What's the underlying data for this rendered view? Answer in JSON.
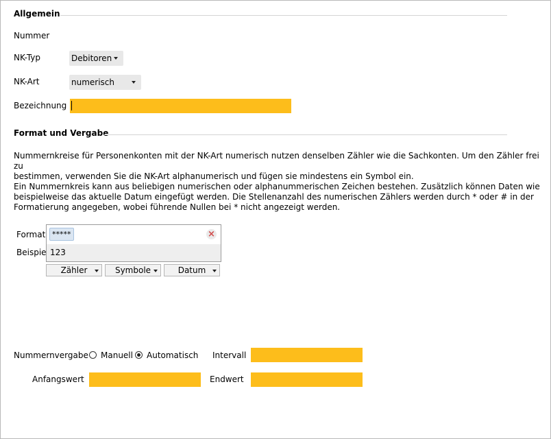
{
  "allgemein": {
    "title": "Allgemein",
    "nummer_label": "Nummer",
    "nktyp_label": "NK-Typ",
    "nktyp_value": "Debitoren",
    "nkart_label": "NK-Art",
    "nkart_value": "numerisch",
    "bezeichnung_label": "Bezeichnung",
    "bezeichnung_value": ""
  },
  "format_section": {
    "title": "Format und Vergabe",
    "paragraph1_line1": "Nummernkreise für Personenkonten mit der NK-Art numerisch nutzen denselben Zähler wie die Sachkonten. Um den Zähler frei zu",
    "paragraph1_line2": "bestimmen, verwenden Sie die NK-Art alphanumerisch und fügen sie mindestens ein Symbol ein.",
    "paragraph2_line1": "Ein Nummernkreis kann aus beliebigen numerischen oder alphanummerischen Zeichen bestehen. Zusätzlich können Daten wie",
    "paragraph2_line2": "beispielweise das aktuelle Datum eingefügt werden. Die Stellenanzahl des numerischen Zählers werden durch * oder # in der",
    "paragraph2_line3": "Formatierung angegeben, wobei führende Nullen bei * nicht angezeigt werden.",
    "format_label": "Format",
    "format_token": "*****",
    "beispiel_label": "Beispiel",
    "beispiel_value": "123",
    "buttons": {
      "zaehler": "Zähler",
      "symbole": "Symbole",
      "datum": "Datum"
    }
  },
  "vergabe": {
    "nummernvergabe_label": "Nummernvergabe",
    "option_manuell": "Manuell",
    "option_automatisch": "Automatisch",
    "selected": "Automatisch",
    "intervall_label": "Intervall",
    "intervall_value": "",
    "anfangswert_label": "Anfangswert",
    "anfangswert_value": "",
    "endwert_label": "Endwert",
    "endwert_value": ""
  },
  "colors": {
    "required_field": "#fdbd1b",
    "dropdown_bg": "#e8e8e8",
    "chip_bg": "#dbe6f2",
    "clear_icon": "#d14b4b"
  },
  "icons": {
    "dropdown": "caret-down",
    "clear": "close-x"
  }
}
